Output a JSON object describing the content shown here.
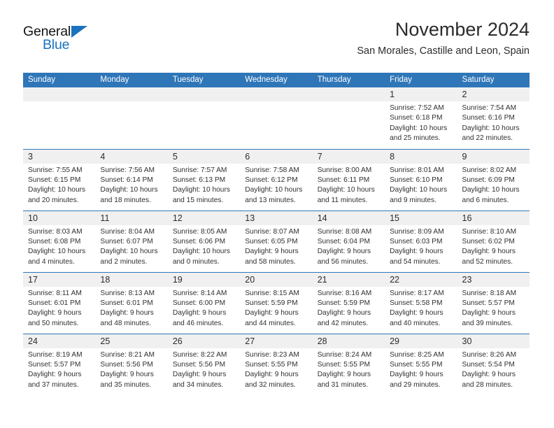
{
  "brand": {
    "name_part1": "General",
    "name_part2": "Blue",
    "accent_color": "#1b72bd",
    "triangle_icon": "triangle-icon"
  },
  "header": {
    "month_title": "November 2024",
    "location": "San Morales, Castille and Leon, Spain"
  },
  "theme": {
    "header_blue": "#2f76b8",
    "daynum_band": "#f0f0f0",
    "text": "#303030"
  },
  "weekday_headers": [
    "Sunday",
    "Monday",
    "Tuesday",
    "Wednesday",
    "Thursday",
    "Friday",
    "Saturday"
  ],
  "weeks": [
    [
      {
        "day": "",
        "empty": true
      },
      {
        "day": "",
        "empty": true
      },
      {
        "day": "",
        "empty": true
      },
      {
        "day": "",
        "empty": true
      },
      {
        "day": "",
        "empty": true
      },
      {
        "day": "1",
        "sunrise": "Sunrise: 7:52 AM",
        "sunset": "Sunset: 6:18 PM",
        "daylight_l1": "Daylight: 10 hours",
        "daylight_l2": "and 25 minutes."
      },
      {
        "day": "2",
        "sunrise": "Sunrise: 7:54 AM",
        "sunset": "Sunset: 6:16 PM",
        "daylight_l1": "Daylight: 10 hours",
        "daylight_l2": "and 22 minutes."
      }
    ],
    [
      {
        "day": "3",
        "sunrise": "Sunrise: 7:55 AM",
        "sunset": "Sunset: 6:15 PM",
        "daylight_l1": "Daylight: 10 hours",
        "daylight_l2": "and 20 minutes."
      },
      {
        "day": "4",
        "sunrise": "Sunrise: 7:56 AM",
        "sunset": "Sunset: 6:14 PM",
        "daylight_l1": "Daylight: 10 hours",
        "daylight_l2": "and 18 minutes."
      },
      {
        "day": "5",
        "sunrise": "Sunrise: 7:57 AM",
        "sunset": "Sunset: 6:13 PM",
        "daylight_l1": "Daylight: 10 hours",
        "daylight_l2": "and 15 minutes."
      },
      {
        "day": "6",
        "sunrise": "Sunrise: 7:58 AM",
        "sunset": "Sunset: 6:12 PM",
        "daylight_l1": "Daylight: 10 hours",
        "daylight_l2": "and 13 minutes."
      },
      {
        "day": "7",
        "sunrise": "Sunrise: 8:00 AM",
        "sunset": "Sunset: 6:11 PM",
        "daylight_l1": "Daylight: 10 hours",
        "daylight_l2": "and 11 minutes."
      },
      {
        "day": "8",
        "sunrise": "Sunrise: 8:01 AM",
        "sunset": "Sunset: 6:10 PM",
        "daylight_l1": "Daylight: 10 hours",
        "daylight_l2": "and 9 minutes."
      },
      {
        "day": "9",
        "sunrise": "Sunrise: 8:02 AM",
        "sunset": "Sunset: 6:09 PM",
        "daylight_l1": "Daylight: 10 hours",
        "daylight_l2": "and 6 minutes."
      }
    ],
    [
      {
        "day": "10",
        "sunrise": "Sunrise: 8:03 AM",
        "sunset": "Sunset: 6:08 PM",
        "daylight_l1": "Daylight: 10 hours",
        "daylight_l2": "and 4 minutes."
      },
      {
        "day": "11",
        "sunrise": "Sunrise: 8:04 AM",
        "sunset": "Sunset: 6:07 PM",
        "daylight_l1": "Daylight: 10 hours",
        "daylight_l2": "and 2 minutes."
      },
      {
        "day": "12",
        "sunrise": "Sunrise: 8:05 AM",
        "sunset": "Sunset: 6:06 PM",
        "daylight_l1": "Daylight: 10 hours",
        "daylight_l2": "and 0 minutes."
      },
      {
        "day": "13",
        "sunrise": "Sunrise: 8:07 AM",
        "sunset": "Sunset: 6:05 PM",
        "daylight_l1": "Daylight: 9 hours",
        "daylight_l2": "and 58 minutes."
      },
      {
        "day": "14",
        "sunrise": "Sunrise: 8:08 AM",
        "sunset": "Sunset: 6:04 PM",
        "daylight_l1": "Daylight: 9 hours",
        "daylight_l2": "and 56 minutes."
      },
      {
        "day": "15",
        "sunrise": "Sunrise: 8:09 AM",
        "sunset": "Sunset: 6:03 PM",
        "daylight_l1": "Daylight: 9 hours",
        "daylight_l2": "and 54 minutes."
      },
      {
        "day": "16",
        "sunrise": "Sunrise: 8:10 AM",
        "sunset": "Sunset: 6:02 PM",
        "daylight_l1": "Daylight: 9 hours",
        "daylight_l2": "and 52 minutes."
      }
    ],
    [
      {
        "day": "17",
        "sunrise": "Sunrise: 8:11 AM",
        "sunset": "Sunset: 6:01 PM",
        "daylight_l1": "Daylight: 9 hours",
        "daylight_l2": "and 50 minutes."
      },
      {
        "day": "18",
        "sunrise": "Sunrise: 8:13 AM",
        "sunset": "Sunset: 6:01 PM",
        "daylight_l1": "Daylight: 9 hours",
        "daylight_l2": "and 48 minutes."
      },
      {
        "day": "19",
        "sunrise": "Sunrise: 8:14 AM",
        "sunset": "Sunset: 6:00 PM",
        "daylight_l1": "Daylight: 9 hours",
        "daylight_l2": "and 46 minutes."
      },
      {
        "day": "20",
        "sunrise": "Sunrise: 8:15 AM",
        "sunset": "Sunset: 5:59 PM",
        "daylight_l1": "Daylight: 9 hours",
        "daylight_l2": "and 44 minutes."
      },
      {
        "day": "21",
        "sunrise": "Sunrise: 8:16 AM",
        "sunset": "Sunset: 5:59 PM",
        "daylight_l1": "Daylight: 9 hours",
        "daylight_l2": "and 42 minutes."
      },
      {
        "day": "22",
        "sunrise": "Sunrise: 8:17 AM",
        "sunset": "Sunset: 5:58 PM",
        "daylight_l1": "Daylight: 9 hours",
        "daylight_l2": "and 40 minutes."
      },
      {
        "day": "23",
        "sunrise": "Sunrise: 8:18 AM",
        "sunset": "Sunset: 5:57 PM",
        "daylight_l1": "Daylight: 9 hours",
        "daylight_l2": "and 39 minutes."
      }
    ],
    [
      {
        "day": "24",
        "sunrise": "Sunrise: 8:19 AM",
        "sunset": "Sunset: 5:57 PM",
        "daylight_l1": "Daylight: 9 hours",
        "daylight_l2": "and 37 minutes."
      },
      {
        "day": "25",
        "sunrise": "Sunrise: 8:21 AM",
        "sunset": "Sunset: 5:56 PM",
        "daylight_l1": "Daylight: 9 hours",
        "daylight_l2": "and 35 minutes."
      },
      {
        "day": "26",
        "sunrise": "Sunrise: 8:22 AM",
        "sunset": "Sunset: 5:56 PM",
        "daylight_l1": "Daylight: 9 hours",
        "daylight_l2": "and 34 minutes."
      },
      {
        "day": "27",
        "sunrise": "Sunrise: 8:23 AM",
        "sunset": "Sunset: 5:55 PM",
        "daylight_l1": "Daylight: 9 hours",
        "daylight_l2": "and 32 minutes."
      },
      {
        "day": "28",
        "sunrise": "Sunrise: 8:24 AM",
        "sunset": "Sunset: 5:55 PM",
        "daylight_l1": "Daylight: 9 hours",
        "daylight_l2": "and 31 minutes."
      },
      {
        "day": "29",
        "sunrise": "Sunrise: 8:25 AM",
        "sunset": "Sunset: 5:55 PM",
        "daylight_l1": "Daylight: 9 hours",
        "daylight_l2": "and 29 minutes."
      },
      {
        "day": "30",
        "sunrise": "Sunrise: 8:26 AM",
        "sunset": "Sunset: 5:54 PM",
        "daylight_l1": "Daylight: 9 hours",
        "daylight_l2": "and 28 minutes."
      }
    ]
  ]
}
